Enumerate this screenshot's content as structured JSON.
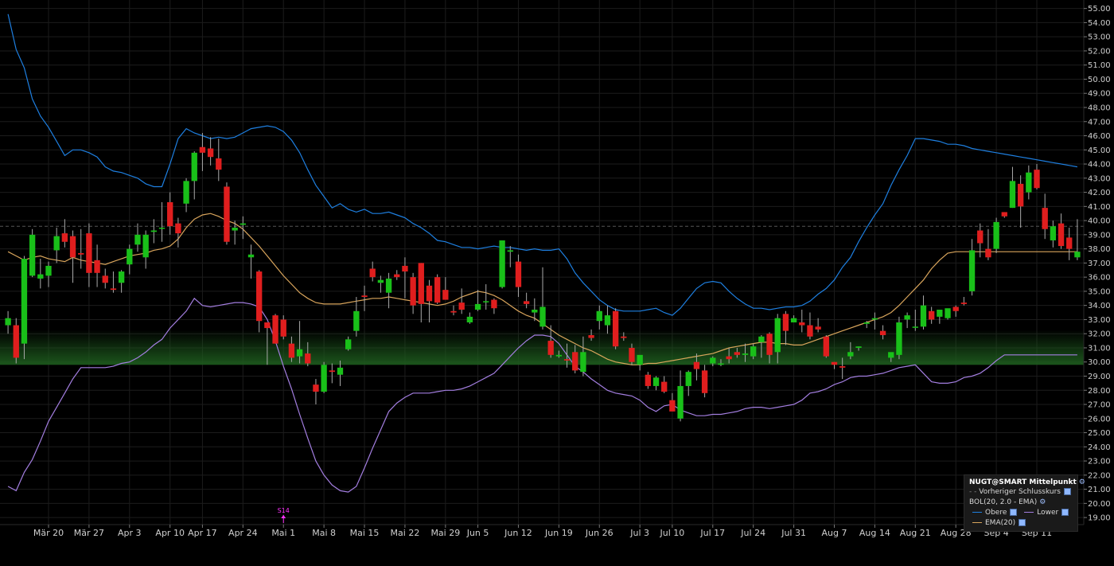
{
  "legend": {
    "title": "NUGT@SMART Mittelpunkt",
    "prev_close": "Vorheriger Schlusskurs",
    "bol": "BOL(20, 2.0 - EMA)",
    "upper": "Obere",
    "lower": "Lower",
    "ema": "EMA(20)"
  },
  "colors": {
    "up": "#19c019",
    "down": "#e01e1e",
    "upper_band": "#1e7fe0",
    "lower_band": "#a37ee0",
    "ema": "#d9a55c",
    "prev_close_line": "#555555",
    "highlight": "#1d5a1d",
    "marker": "#ff33ff"
  },
  "chart_data": {
    "type": "candlestick",
    "ylim": [
      18.5,
      55.6
    ],
    "y_ticks": [
      "19.00",
      "20.00",
      "21.00",
      "22.00",
      "23.00",
      "24.00",
      "25.00",
      "26.00",
      "27.00",
      "28.00",
      "29.00",
      "30.00",
      "31.00",
      "32.00",
      "33.00",
      "34.00",
      "35.00",
      "36.00",
      "37.00",
      "38.00",
      "39.00",
      "40.00",
      "41.00",
      "42.00",
      "43.00",
      "44.00",
      "45.00",
      "46.00",
      "47.00",
      "48.00",
      "49.00",
      "50.00",
      "51.00",
      "52.00",
      "53.00",
      "54.00",
      "55.00"
    ],
    "x_ticks": [
      {
        "label": "Mär 20",
        "index": 5
      },
      {
        "label": "Mär 27",
        "index": 10
      },
      {
        "label": "Apr 3",
        "index": 15
      },
      {
        "label": "Apr 10",
        "index": 20
      },
      {
        "label": "Apr 17",
        "index": 24
      },
      {
        "label": "Apr 24",
        "index": 29
      },
      {
        "label": "Mai 1",
        "index": 34
      },
      {
        "label": "Mai 8",
        "index": 39
      },
      {
        "label": "Mai 15",
        "index": 44
      },
      {
        "label": "Mai 22",
        "index": 49
      },
      {
        "label": "Mai 29",
        "index": 54
      },
      {
        "label": "Jun 5",
        "index": 58
      },
      {
        "label": "Jun 12",
        "index": 63
      },
      {
        "label": "Jun 19",
        "index": 68
      },
      {
        "label": "Jun 26",
        "index": 73
      },
      {
        "label": "Jul 3",
        "index": 78
      },
      {
        "label": "Jul 10",
        "index": 82
      },
      {
        "label": "Jul 17",
        "index": 87
      },
      {
        "label": "Jul 24",
        "index": 92
      },
      {
        "label": "Jul 31",
        "index": 97
      },
      {
        "label": "Aug 7",
        "index": 102
      },
      {
        "label": "Aug 14",
        "index": 107
      },
      {
        "label": "Aug 21",
        "index": 112
      },
      {
        "label": "Aug 28",
        "index": 117
      },
      {
        "label": "Sep 4",
        "index": 122
      },
      {
        "label": "Sep 11",
        "index": 127
      }
    ],
    "previous_close": 39.6,
    "highlight_band": [
      29.8,
      32.3
    ],
    "marker": {
      "label": "S14",
      "index": 34
    },
    "ohlc": [
      [
        32.6,
        33.6,
        32.0,
        33.1
      ],
      [
        32.6,
        33.1,
        29.9,
        30.3
      ],
      [
        31.3,
        37.5,
        30.2,
        37.3
      ],
      [
        36.1,
        39.4,
        36.0,
        39.0
      ],
      [
        35.9,
        37.3,
        35.2,
        36.2
      ],
      [
        36.1,
        37.1,
        35.3,
        36.8
      ],
      [
        37.9,
        39.5,
        37.0,
        38.9
      ],
      [
        39.1,
        40.1,
        38.1,
        38.5
      ],
      [
        38.9,
        39.3,
        35.6,
        37.4
      ],
      [
        37.7,
        39.4,
        36.6,
        37.6
      ],
      [
        39.1,
        39.8,
        35.3,
        36.3
      ],
      [
        37.2,
        38.3,
        35.3,
        36.3
      ],
      [
        36.1,
        36.6,
        35.2,
        35.6
      ],
      [
        35.2,
        36.4,
        34.9,
        35.1
      ],
      [
        35.6,
        36.5,
        34.9,
        36.4
      ],
      [
        36.9,
        38.3,
        36.2,
        38.0
      ],
      [
        38.3,
        39.8,
        37.8,
        39.0
      ],
      [
        37.4,
        39.3,
        36.6,
        39.0
      ],
      [
        39.2,
        40.1,
        38.4,
        39.3
      ],
      [
        39.5,
        41.3,
        38.5,
        39.5
      ],
      [
        41.3,
        42.0,
        39.0,
        39.6
      ],
      [
        39.8,
        40.2,
        38.1,
        39.1
      ],
      [
        41.2,
        43.0,
        40.6,
        42.8
      ],
      [
        42.8,
        44.9,
        41.5,
        44.8
      ],
      [
        45.2,
        46.2,
        43.5,
        44.8
      ],
      [
        45.1,
        45.9,
        43.9,
        44.5
      ],
      [
        44.4,
        45.8,
        42.8,
        43.6
      ],
      [
        42.4,
        42.7,
        38.3,
        38.5
      ],
      [
        39.3,
        40.0,
        38.3,
        39.5
      ],
      [
        39.7,
        40.3,
        38.7,
        39.8
      ],
      [
        37.4,
        38.3,
        35.9,
        37.6
      ],
      [
        36.4,
        36.5,
        32.1,
        32.9
      ],
      [
        32.8,
        32.8,
        29.8,
        32.4
      ],
      [
        33.3,
        33.4,
        31.3,
        31.3
      ],
      [
        33.0,
        33.3,
        31.6,
        31.8
      ],
      [
        31.3,
        31.8,
        30.0,
        30.3
      ],
      [
        30.4,
        32.9,
        29.9,
        30.9
      ],
      [
        30.6,
        31.4,
        29.7,
        29.9
      ],
      [
        28.4,
        28.8,
        27.0,
        27.9
      ],
      [
        27.9,
        30.0,
        27.8,
        29.8
      ],
      [
        29.4,
        29.9,
        28.5,
        29.3
      ],
      [
        29.1,
        30.1,
        28.3,
        29.6
      ],
      [
        30.9,
        31.8,
        30.8,
        31.6
      ],
      [
        32.2,
        34.6,
        31.8,
        33.6
      ],
      [
        34.7,
        35.4,
        33.6,
        34.6
      ],
      [
        36.6,
        37.1,
        35.7,
        36.0
      ],
      [
        35.6,
        36.1,
        34.9,
        35.8
      ],
      [
        34.9,
        36.3,
        33.8,
        35.9
      ],
      [
        36.2,
        36.5,
        35.8,
        36.0
      ],
      [
        36.8,
        37.4,
        34.5,
        36.4
      ],
      [
        36.0,
        36.3,
        33.4,
        34.0
      ],
      [
        37.0,
        37.0,
        32.8,
        34.1
      ],
      [
        35.4,
        35.8,
        32.8,
        34.3
      ],
      [
        36.0,
        36.2,
        34.1,
        34.2
      ],
      [
        35.1,
        36.0,
        34.6,
        34.4
      ],
      [
        33.6,
        34.0,
        33.3,
        33.5
      ],
      [
        34.2,
        35.2,
        33.4,
        33.7
      ],
      [
        32.8,
        33.5,
        32.7,
        33.2
      ],
      [
        33.7,
        35.1,
        33.6,
        34.1
      ],
      [
        34.3,
        35.5,
        33.7,
        34.3
      ],
      [
        34.4,
        34.5,
        33.4,
        33.8
      ],
      [
        35.3,
        38.6,
        35.2,
        38.6
      ],
      [
        37.8,
        38.2,
        36.7,
        37.9
      ],
      [
        37.1,
        37.6,
        34.6,
        35.3
      ],
      [
        34.3,
        34.9,
        33.8,
        34.1
      ],
      [
        33.5,
        34.5,
        32.9,
        33.7
      ],
      [
        32.5,
        36.7,
        32.3,
        33.9
      ],
      [
        31.5,
        32.6,
        30.3,
        30.5
      ],
      [
        30.4,
        30.8,
        30.3,
        30.5
      ],
      [
        30.2,
        31.3,
        29.6,
        30.1
      ],
      [
        30.7,
        31.2,
        29.2,
        29.4
      ],
      [
        29.3,
        31.8,
        29.0,
        30.7
      ],
      [
        31.9,
        32.3,
        31.5,
        31.7
      ],
      [
        32.9,
        34.0,
        32.3,
        33.6
      ],
      [
        32.6,
        34.0,
        32.0,
        33.3
      ],
      [
        33.6,
        33.8,
        30.9,
        31.1
      ],
      [
        31.8,
        32.1,
        31.5,
        31.7
      ],
      [
        31.0,
        31.3,
        29.8,
        30.0
      ],
      [
        29.8,
        30.3,
        29.4,
        30.5
      ],
      [
        29.1,
        29.3,
        28.1,
        28.3
      ],
      [
        28.3,
        29.0,
        28.0,
        28.9
      ],
      [
        28.6,
        29.0,
        27.8,
        27.9
      ],
      [
        27.3,
        27.8,
        26.6,
        26.5
      ],
      [
        26.0,
        29.4,
        25.8,
        28.3
      ],
      [
        28.3,
        29.4,
        27.6,
        29.3
      ],
      [
        30.0,
        30.6,
        28.7,
        29.5
      ],
      [
        29.4,
        29.8,
        27.5,
        27.8
      ],
      [
        29.9,
        30.4,
        29.7,
        30.3
      ],
      [
        29.8,
        30.2,
        29.7,
        29.9
      ],
      [
        30.4,
        31.0,
        29.9,
        30.2
      ],
      [
        30.7,
        31.0,
        30.3,
        30.5
      ],
      [
        30.5,
        31.3,
        30.0,
        30.6
      ],
      [
        30.4,
        31.3,
        30.2,
        31.1
      ],
      [
        31.4,
        31.9,
        30.3,
        31.8
      ],
      [
        32.0,
        32.1,
        29.9,
        30.5
      ],
      [
        30.7,
        33.4,
        29.9,
        33.1
      ],
      [
        33.4,
        33.6,
        31.2,
        32.2
      ],
      [
        32.8,
        33.3,
        32.8,
        33.1
      ],
      [
        32.8,
        33.7,
        32.1,
        32.6
      ],
      [
        32.6,
        33.5,
        31.6,
        31.8
      ],
      [
        32.5,
        33.1,
        32.1,
        32.3
      ],
      [
        31.8,
        31.9,
        30.3,
        30.4
      ],
      [
        30.0,
        30.0,
        29.5,
        29.8
      ],
      [
        29.7,
        30.3,
        28.8,
        29.6
      ],
      [
        30.4,
        31.4,
        30.2,
        30.7
      ],
      [
        31.0,
        31.1,
        30.8,
        31.1
      ],
      [
        32.7,
        32.9,
        32.4,
        32.8
      ],
      [
        33.0,
        33.5,
        32.3,
        33.1
      ],
      [
        32.2,
        32.6,
        31.6,
        31.9
      ],
      [
        30.3,
        30.5,
        30.0,
        30.7
      ],
      [
        30.5,
        33.2,
        30.2,
        32.8
      ],
      [
        33.0,
        33.5,
        32.4,
        33.3
      ],
      [
        32.5,
        33.7,
        32.2,
        32.5
      ],
      [
        32.5,
        34.7,
        32.3,
        34.0
      ],
      [
        33.6,
        33.9,
        32.7,
        33.0
      ],
      [
        33.2,
        33.5,
        32.7,
        33.7
      ],
      [
        33.1,
        33.6,
        33.0,
        33.8
      ],
      [
        33.9,
        34.0,
        33.2,
        33.6
      ],
      [
        34.2,
        34.6,
        34.0,
        34.1
      ],
      [
        35.0,
        38.7,
        34.7,
        37.9
      ],
      [
        39.3,
        39.8,
        37.4,
        38.4
      ],
      [
        38.0,
        39.4,
        37.2,
        37.4
      ],
      [
        38.0,
        40.2,
        37.7,
        39.9
      ],
      [
        40.6,
        40.6,
        40.2,
        40.3
      ],
      [
        40.9,
        43.8,
        40.9,
        42.8
      ],
      [
        42.6,
        43.2,
        39.5,
        41.0
      ],
      [
        42.0,
        43.9,
        41.5,
        43.4
      ],
      [
        43.6,
        44.0,
        42.2,
        42.3
      ],
      [
        40.9,
        41.9,
        38.7,
        39.4
      ],
      [
        38.6,
        40.0,
        38.1,
        39.6
      ],
      [
        39.8,
        40.5,
        38.0,
        38.2
      ],
      [
        38.8,
        39.5,
        37.2,
        38.0
      ],
      [
        37.4,
        40.1,
        37.2,
        37.8
      ]
    ],
    "series": [
      {
        "name": "Obere",
        "values": [
          54.6,
          52.1,
          50.8,
          48.6,
          47.4,
          46.6,
          45.6,
          44.6,
          45.0,
          45.0,
          44.8,
          44.5,
          43.8,
          43.5,
          43.4,
          43.2,
          43.0,
          42.6,
          42.4,
          42.4,
          44.0,
          45.8,
          46.5,
          46.2,
          46.0,
          45.8,
          45.9,
          45.8,
          45.9,
          46.2,
          46.5,
          46.6,
          46.7,
          46.6,
          46.3,
          45.7,
          44.8,
          43.6,
          42.5,
          41.7,
          40.9,
          41.2,
          40.8,
          40.6,
          40.8,
          40.5,
          40.5,
          40.6,
          40.4,
          40.2,
          39.8,
          39.5,
          39.1,
          38.6,
          38.5,
          38.3,
          38.1,
          38.1,
          38.0,
          38.1,
          38.2,
          38.1,
          38.1,
          38.0,
          37.9,
          38.0,
          37.9,
          37.9,
          38.0,
          37.3,
          36.3,
          35.6,
          35.0,
          34.4,
          34.0,
          33.7,
          33.6,
          33.6,
          33.6,
          33.7,
          33.8,
          33.5,
          33.3,
          33.8,
          34.5,
          35.2,
          35.6,
          35.7,
          35.6,
          35.0,
          34.5,
          34.1,
          33.8,
          33.8,
          33.7,
          33.8,
          33.9,
          33.9,
          34.0,
          34.3,
          34.8,
          35.2,
          35.8,
          36.7,
          37.4,
          38.5,
          39.5,
          40.4,
          41.2,
          42.5,
          43.6,
          44.6,
          45.8,
          45.8,
          45.7,
          45.6,
          45.4,
          45.4,
          45.3,
          45.1,
          45.0,
          44.9,
          44.8,
          44.7,
          44.6,
          44.5,
          44.4,
          44.3,
          44.2,
          44.1,
          44.0,
          43.9,
          43.8
        ]
      },
      {
        "name": "EMA(20)",
        "values": [
          37.8,
          37.5,
          37.2,
          37.4,
          37.5,
          37.3,
          37.2,
          37.1,
          37.4,
          37.2,
          37.1,
          37.0,
          36.9,
          37.1,
          37.3,
          37.5,
          37.6,
          37.7,
          37.9,
          38.0,
          38.2,
          38.7,
          39.5,
          40.1,
          40.4,
          40.5,
          40.3,
          40.0,
          39.8,
          39.4,
          38.8,
          38.2,
          37.5,
          36.8,
          36.1,
          35.5,
          34.9,
          34.5,
          34.2,
          34.1,
          34.1,
          34.1,
          34.2,
          34.3,
          34.4,
          34.5,
          34.5,
          34.6,
          34.5,
          34.4,
          34.3,
          34.2,
          34.1,
          34.0,
          34.1,
          34.3,
          34.6,
          34.8,
          35.0,
          34.9,
          34.7,
          34.4,
          34.0,
          33.6,
          33.3,
          33.1,
          32.7,
          32.3,
          31.9,
          31.6,
          31.3,
          31.0,
          30.8,
          30.5,
          30.2,
          30.0,
          29.9,
          29.8,
          29.8,
          29.9,
          29.9,
          30.0,
          30.1,
          30.2,
          30.3,
          30.4,
          30.5,
          30.6,
          30.8,
          31.0,
          31.1,
          31.2,
          31.3,
          31.4,
          31.4,
          31.3,
          31.3,
          31.2,
          31.2,
          31.4,
          31.6,
          31.8,
          32.0,
          32.2,
          32.4,
          32.6,
          32.8,
          33.0,
          33.2,
          33.5,
          34.0,
          34.6,
          35.2,
          35.8,
          36.6,
          37.2,
          37.7,
          37.8,
          37.8,
          37.8,
          37.8,
          37.8,
          37.8,
          37.8,
          37.8,
          37.8,
          37.8,
          37.8,
          37.8,
          37.8,
          37.8,
          37.8,
          37.8
        ]
      },
      {
        "name": "Lower",
        "values": [
          21.2,
          20.9,
          22.2,
          23.1,
          24.4,
          25.8,
          26.8,
          27.8,
          28.8,
          29.6,
          29.6,
          29.6,
          29.6,
          29.7,
          29.9,
          30.0,
          30.3,
          30.7,
          31.2,
          31.6,
          32.4,
          33.0,
          33.6,
          34.5,
          34.0,
          33.9,
          34.0,
          34.1,
          34.2,
          34.2,
          34.1,
          33.9,
          33.0,
          31.5,
          29.7,
          28.1,
          26.3,
          24.6,
          23.0,
          22.0,
          21.3,
          20.9,
          20.8,
          21.2,
          22.5,
          23.9,
          25.2,
          26.5,
          27.1,
          27.5,
          27.8,
          27.8,
          27.8,
          27.9,
          28.0,
          28.0,
          28.1,
          28.3,
          28.6,
          28.9,
          29.2,
          29.8,
          30.4,
          31.0,
          31.5,
          31.9,
          31.9,
          31.8,
          31.3,
          30.5,
          29.7,
          29.3,
          28.8,
          28.4,
          28.0,
          27.8,
          27.7,
          27.6,
          27.3,
          26.8,
          26.5,
          26.9,
          27.0,
          26.6,
          26.4,
          26.2,
          26.2,
          26.3,
          26.3,
          26.4,
          26.5,
          26.7,
          26.8,
          26.8,
          26.7,
          26.8,
          26.9,
          27.0,
          27.3,
          27.8,
          27.9,
          28.1,
          28.4,
          28.6,
          28.9,
          29.0,
          29.0,
          29.1,
          29.2,
          29.4,
          29.6,
          29.7,
          29.8,
          29.2,
          28.6,
          28.5,
          28.5,
          28.6,
          28.9,
          29.0,
          29.2,
          29.6,
          30.1,
          30.5,
          30.5,
          30.5,
          30.5,
          30.5,
          30.5,
          30.5,
          30.5,
          30.5,
          30.5
        ]
      }
    ]
  }
}
